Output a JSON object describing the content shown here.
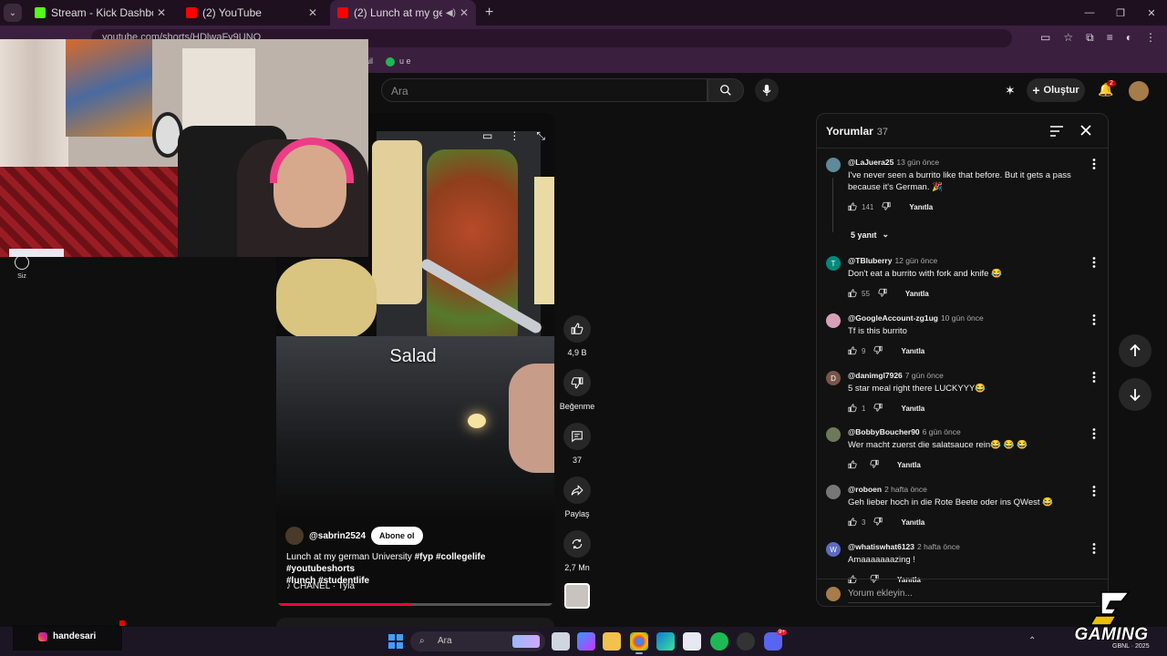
{
  "browser": {
    "tabs": [
      {
        "label": "Stream - Kick Dashboard",
        "favicon_color": "#53fc18",
        "active": false
      },
      {
        "label": "(2) YouTube",
        "favicon_color": "#ff0000",
        "active": false
      },
      {
        "label": "(2) Lunch at my german Uni",
        "favicon_color": "#ff0000",
        "active": true
      }
    ],
    "url": "youtube.com/shorts/HDlwaFy9UNQ",
    "bookmarks": [
      "ail",
      "u e"
    ]
  },
  "youtube": {
    "search_placeholder": "Ara",
    "create_label": "Oluştur",
    "notification_count": "2",
    "you_label": "Siz"
  },
  "video": {
    "caption": "Salad",
    "channel": "@sabrin2524",
    "subscribe_label": "Abone ol",
    "title_plain": "Lunch at my german University ",
    "hashtags_line1": "#fyp #collegelife #youtubeshorts",
    "hashtags_line2": "#lunch #studentlife",
    "music": "CHANEL · Tyla",
    "progress_fraction": 0.49
  },
  "actions": {
    "likes": "4,9 B",
    "dislike_label": "Beğenme",
    "comments": "37",
    "share_label": "Paylaş",
    "remix": "2,7 Mn"
  },
  "comments_panel": {
    "title": "Yorumlar",
    "count": "37",
    "replies_label": "5 yanıt",
    "reply_label": "Yanıtla",
    "input_placeholder": "Yorum ekleyin...",
    "items": [
      {
        "author": "@LaJuera25",
        "time": "13 gün önce",
        "text": "I've never seen a burrito like that before. But it gets a pass because it's German. 🎉",
        "likes": "141",
        "avatar_color": "#5e8a99",
        "avatar_letter": ""
      },
      {
        "author": "@TBluberry",
        "time": "12 gün önce",
        "text": "Don't eat a burrito with fork and knife 😂",
        "likes": "55",
        "avatar_color": "#00897b",
        "avatar_letter": "T"
      },
      {
        "author": "@GoogleAccount-zg1ug",
        "time": "10 gün önce",
        "text": "Tf is this burrito",
        "likes": "9",
        "avatar_color": "#d8a0b8",
        "avatar_letter": ""
      },
      {
        "author": "@danimgl7926",
        "time": "7 gün önce",
        "text": "5 star meal right there LUCKYYY😂",
        "likes": "1",
        "avatar_color": "#795548",
        "avatar_letter": "D"
      },
      {
        "author": "@BobbyBoucher90",
        "time": "6 gün önce",
        "text": "Wer macht zuerst die salatsauce rein😂 😂 😂",
        "likes": "",
        "avatar_color": "#6d7a5a",
        "avatar_letter": ""
      },
      {
        "author": "@roboen",
        "time": "2 hafta önce",
        "text": "Geh lieber hoch in die Rote Beete oder ins QWest 😂",
        "likes": "3",
        "avatar_color": "#777777",
        "avatar_letter": ""
      },
      {
        "author": "@whatiswhat6123",
        "time": "2 hafta önce",
        "text": "Amaaaaaaazing !",
        "likes": "",
        "avatar_color": "#5c6bc0",
        "avatar_letter": "W"
      }
    ]
  },
  "taskbar": {
    "search_label": "Ara",
    "discord_badge": "9+"
  },
  "overlay": {
    "instagram_handle": "handesari",
    "logo_text": "GAMING",
    "logo_sub": "GBNL · 2025"
  }
}
